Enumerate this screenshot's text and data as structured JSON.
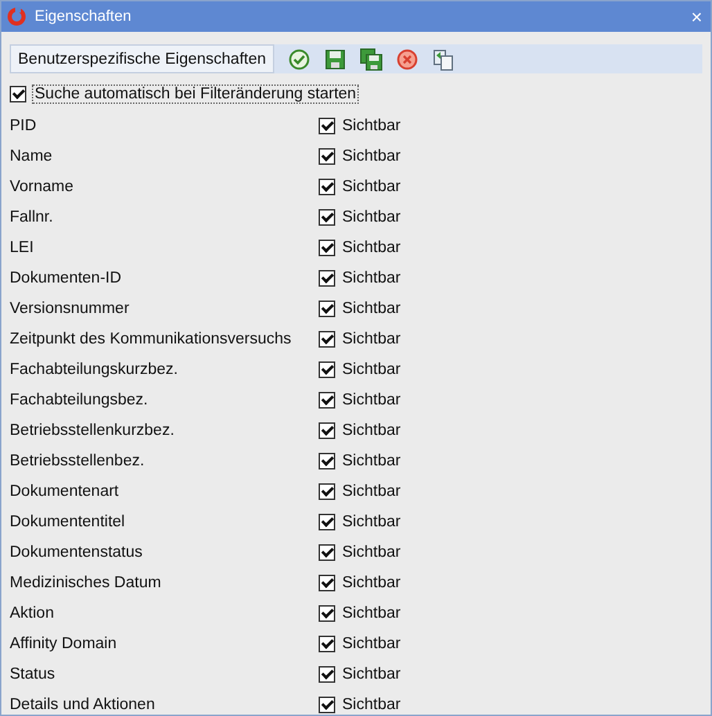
{
  "window": {
    "title": "Eigenschaften",
    "close": "×"
  },
  "tabs": [
    {
      "label": "Benutzerspezifische Eigenschaften",
      "selected": true
    }
  ],
  "toolbar": [
    {
      "kind": "apply"
    },
    {
      "kind": "save"
    },
    {
      "kind": "save-all"
    },
    {
      "kind": "cancel"
    },
    {
      "kind": "copy"
    }
  ],
  "auto_search": {
    "label": "Suche automatisch bei Filteränderung starten",
    "checked": true
  },
  "properties": [
    {
      "name": "PID",
      "label": "Sichtbar",
      "checked": true
    },
    {
      "name": "Name",
      "label": "Sichtbar",
      "checked": true
    },
    {
      "name": "Vorname",
      "label": "Sichtbar",
      "checked": true
    },
    {
      "name": "Fallnr.",
      "label": "Sichtbar",
      "checked": true
    },
    {
      "name": "LEI",
      "label": "Sichtbar",
      "checked": true
    },
    {
      "name": "Dokumenten-ID",
      "label": "Sichtbar",
      "checked": true
    },
    {
      "name": "Versionsnummer",
      "label": "Sichtbar",
      "checked": true
    },
    {
      "name": "Zeitpunkt des Kommunikationsversuchs",
      "label": "Sichtbar",
      "checked": true
    },
    {
      "name": "Fachabteilungskurzbez.",
      "label": "Sichtbar",
      "checked": true
    },
    {
      "name": "Fachabteilungsbez.",
      "label": "Sichtbar",
      "checked": true
    },
    {
      "name": "Betriebsstellenkurzbez.",
      "label": "Sichtbar",
      "checked": true
    },
    {
      "name": "Betriebsstellenbez.",
      "label": "Sichtbar",
      "checked": true
    },
    {
      "name": "Dokumentenart",
      "label": "Sichtbar",
      "checked": true
    },
    {
      "name": "Dokumententitel",
      "label": "Sichtbar",
      "checked": true
    },
    {
      "name": "Dokumentenstatus",
      "label": "Sichtbar",
      "checked": true
    },
    {
      "name": "Medizinisches Datum",
      "label": "Sichtbar",
      "checked": true
    },
    {
      "name": "Aktion",
      "label": "Sichtbar",
      "checked": true
    },
    {
      "name": "Affinity Domain",
      "label": "Sichtbar",
      "checked": true
    },
    {
      "name": "Status",
      "label": "Sichtbar",
      "checked": true
    },
    {
      "name": "Details und Aktionen",
      "label": "Sichtbar",
      "checked": true
    }
  ]
}
